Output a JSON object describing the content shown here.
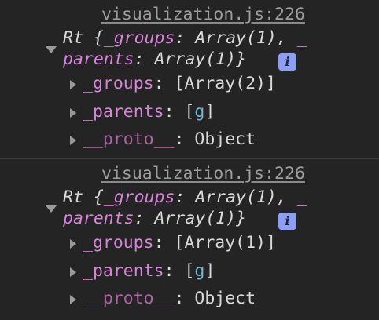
{
  "entries": [
    {
      "source": "visualization.js:226",
      "summary": {
        "class_name": "Rt",
        "open": " {",
        "key1": "_groups",
        "sep1": ": ",
        "val1": "Array(1)",
        "comma": ", ",
        "underscore": "_",
        "key2": "parents",
        "sep2": ": ",
        "val2": "Array(1)",
        "close": "}"
      },
      "info_badge": "i",
      "properties": [
        {
          "name": "_groups",
          "colon": ": ",
          "value": "[Array(2)]"
        },
        {
          "name": "_parents",
          "colon": ": ",
          "open": "[",
          "value": "g",
          "close": "]"
        },
        {
          "name": "__proto__",
          "colon": ": ",
          "value": "Object"
        }
      ]
    },
    {
      "source": "visualization.js:226",
      "summary": {
        "class_name": "Rt",
        "open": " {",
        "key1": "_groups",
        "sep1": ": ",
        "val1": "Array(1)",
        "comma": ", ",
        "underscore": "_",
        "key2": "parents",
        "sep2": ": ",
        "val2": "Array(1)",
        "close": "}"
      },
      "info_badge": "i",
      "properties": [
        {
          "name": "_groups",
          "colon": ": ",
          "value": "[Array(1)]"
        },
        {
          "name": "_parents",
          "colon": ": ",
          "open": "[",
          "value": "g",
          "close": "]"
        },
        {
          "name": "__proto__",
          "colon": ": ",
          "value": "Object"
        }
      ]
    }
  ],
  "colors": {
    "background": "#242424",
    "property_name": "#d684d8",
    "proto_name": "#a7679c",
    "element_tag": "#73b6cf",
    "info_badge": "#8d9ff3"
  },
  "icons": {
    "expanded": "triangle-down-icon",
    "collapsed": "triangle-right-icon",
    "info": "info-icon"
  }
}
